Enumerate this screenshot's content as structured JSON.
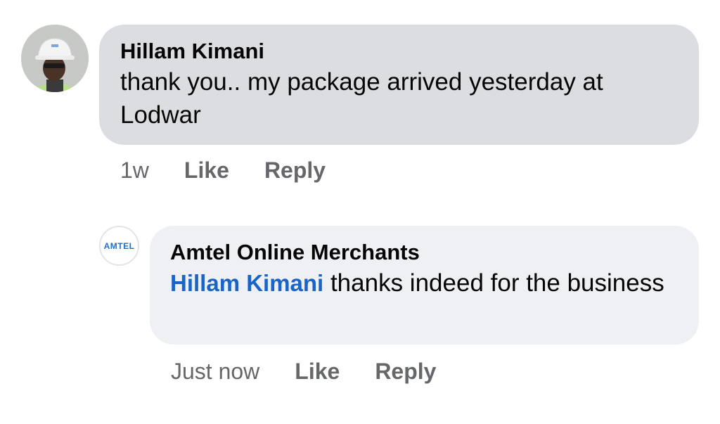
{
  "comments": [
    {
      "author": "Hillam Kimani",
      "text": "thank you.. my package arrived yesterday at Lodwar",
      "time": "1w",
      "like_label": "Like",
      "reply_label": "Reply"
    },
    {
      "author": "Amtel Online Merchants",
      "logo_text": "AMTEL",
      "mention": "Hillam Kimani",
      "text": " thanks indeed for the business",
      "time": "Just now",
      "like_label": "Like",
      "reply_label": "Reply"
    }
  ],
  "colors": {
    "bubble_primary": "#dcdde1",
    "bubble_reply": "#eff0f4",
    "mention": "#1a64c7",
    "secondary_text": "#65676b"
  }
}
